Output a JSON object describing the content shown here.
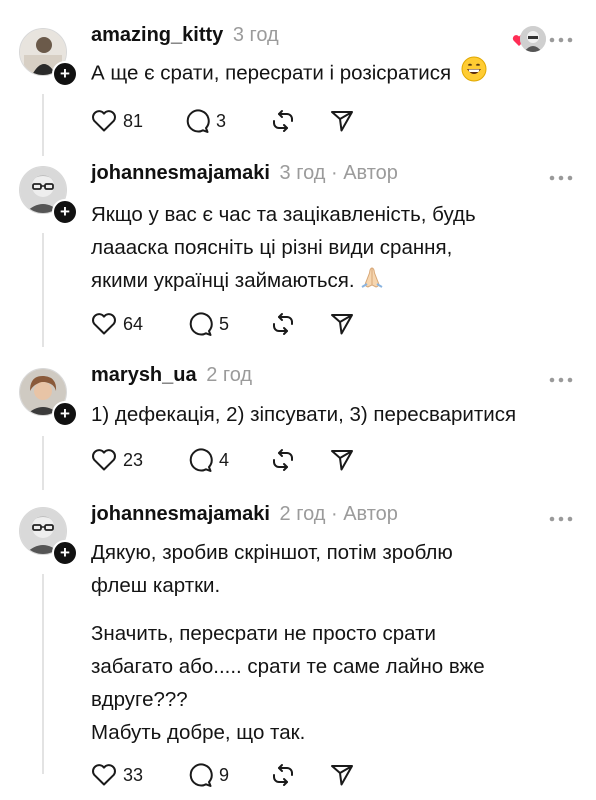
{
  "comments": [
    {
      "username": "amazing_kitty",
      "meta": "3 год",
      "lines": [
        "А ще є срати, пересрати і розісратися"
      ],
      "likes": "81",
      "replies": "3",
      "emoji": "grinning-face"
    },
    {
      "username": "johannesmajamaki",
      "meta": "3 год · Автор",
      "lines": [
        "Якщо у вас є час та зацікавленість, будь",
        "лааaска поясніть ці різні види срання,",
        "якими українці займаються."
      ],
      "likes": "64",
      "replies": "5",
      "emoji": "folded-hands"
    },
    {
      "username": "marysh_ua",
      "meta": "2 год",
      "lines": [
        "1) дефекація, 2) зіпсувати, 3) пересваритися"
      ],
      "likes": "23",
      "replies": "4"
    },
    {
      "username": "johannesmajamaki",
      "meta": "2 год · Автор",
      "lines": [
        "Дякую, зробив скріншот, потім зроблю",
        "флеш картки.",
        "Значить, пересрати не просто срати",
        "забагато або..... срати те саме лайно вже",
        "вдруге???",
        "Мабуть добре, що так."
      ],
      "likes": "33",
      "replies": "9"
    }
  ]
}
